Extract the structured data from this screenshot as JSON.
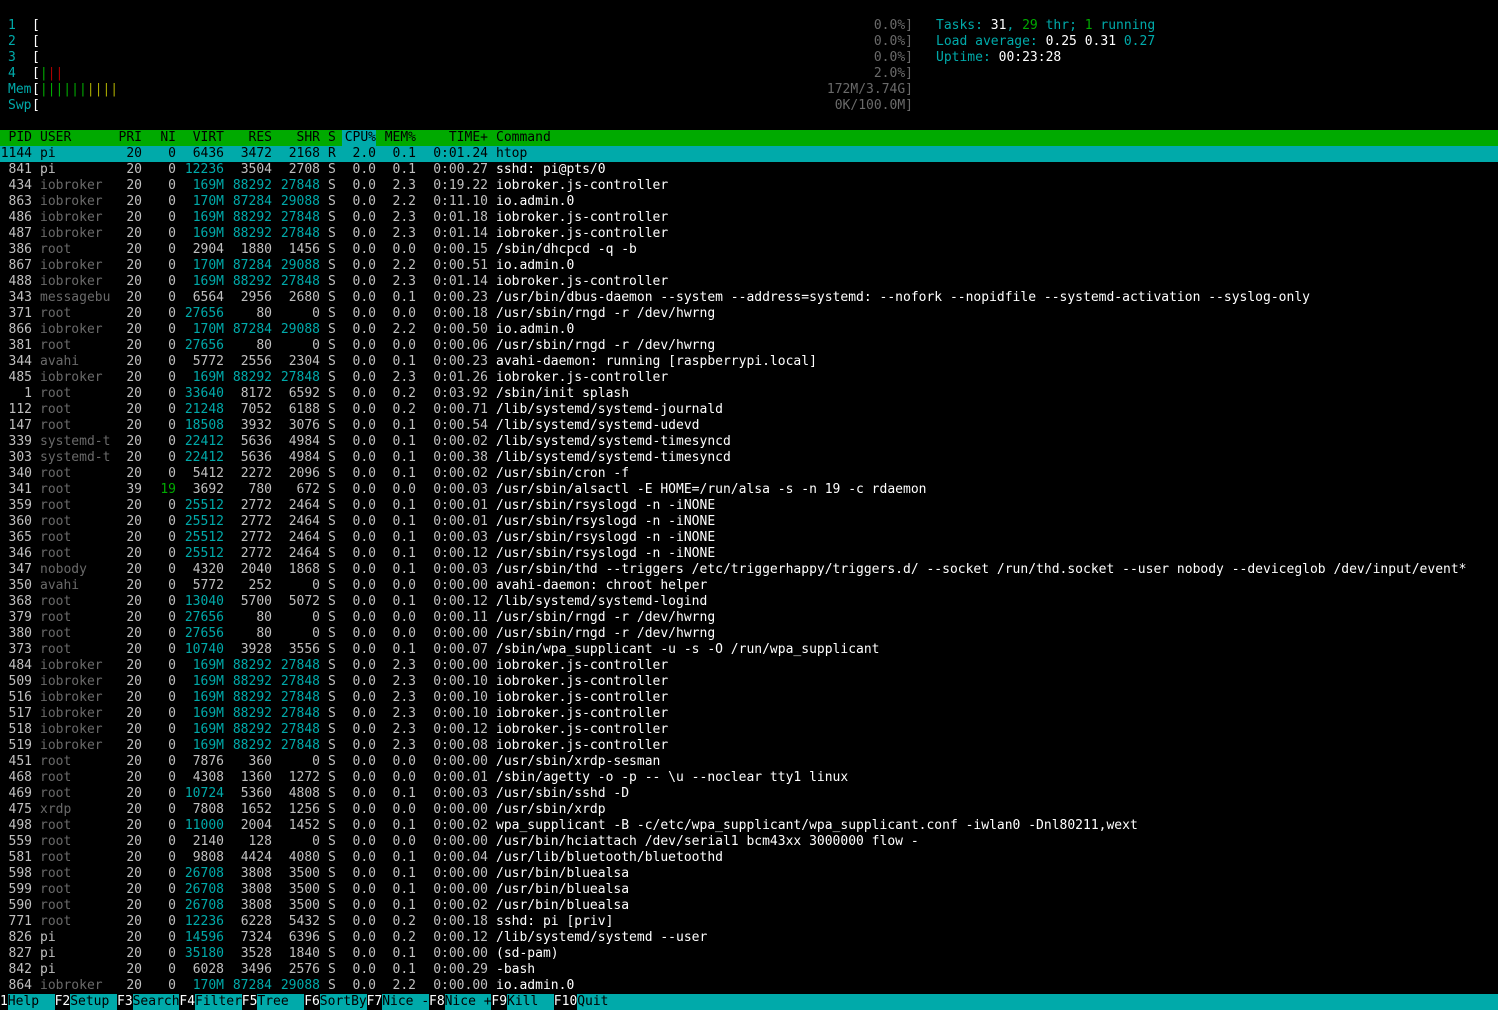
{
  "meters": [
    {
      "label": "1",
      "bar_segments": [],
      "value": "0.0%]"
    },
    {
      "label": "2",
      "bar_segments": [],
      "value": "0.0%]"
    },
    {
      "label": "3",
      "bar_segments": [],
      "value": "0.0%]"
    },
    {
      "label": "4",
      "bar_segments": [
        {
          "text": "|",
          "cls": "g"
        },
        {
          "text": "||",
          "cls": "r"
        }
      ],
      "value": "2.0%]"
    },
    {
      "label": "Mem",
      "bar_segments": [
        {
          "text": "||||||",
          "cls": "g"
        },
        {
          "text": "||||",
          "cls": "y"
        }
      ],
      "value": "172M/3.74G]"
    },
    {
      "label": "Swp",
      "bar_segments": [],
      "value": "0K/100.0M]"
    }
  ],
  "summary": {
    "tasks_label": "Tasks: ",
    "tasks_count": "31",
    "tasks_sep": ", ",
    "thr_count": "29",
    "thr_label": " thr; ",
    "running_count": "1",
    "running_label": " running",
    "load_label": "Load average: ",
    "load_1": "0.25",
    "load_5": "0.31",
    "load_15": "0.27",
    "uptime_label": "Uptime: ",
    "uptime": "00:23:28"
  },
  "columns": {
    "pid": "PID",
    "user": "USER",
    "pri": "PRI",
    "ni": "NI",
    "virt": "VIRT",
    "res": "RES",
    "shr": "SHR",
    "s": "S",
    "cpu": "CPU%",
    "mem": "MEM%",
    "time": "TIME+",
    "command": "Command"
  },
  "processes": [
    [
      "1144",
      "pi",
      "20",
      "0",
      "6436",
      "3472",
      "2168",
      "R",
      "2.0",
      "0.1",
      "0:01.24",
      "htop",
      "sel"
    ],
    [
      "841",
      "pi",
      "20",
      "0",
      "12236",
      "3504",
      "2708",
      "S",
      "0.0",
      "0.1",
      "0:00.27",
      "sshd: pi@pts/0",
      ""
    ],
    [
      "434",
      "iobroker",
      "20",
      "0",
      "169M",
      "88292",
      "27848",
      "S",
      "0.0",
      "2.3",
      "0:19.22",
      "iobroker.js-controller",
      ""
    ],
    [
      "863",
      "iobroker",
      "20",
      "0",
      "170M",
      "87284",
      "29088",
      "S",
      "0.0",
      "2.2",
      "0:11.10",
      "io.admin.0",
      ""
    ],
    [
      "486",
      "iobroker",
      "20",
      "0",
      "169M",
      "88292",
      "27848",
      "S",
      "0.0",
      "2.3",
      "0:01.18",
      "iobroker.js-controller",
      "thr"
    ],
    [
      "487",
      "iobroker",
      "20",
      "0",
      "169M",
      "88292",
      "27848",
      "S",
      "0.0",
      "2.3",
      "0:01.14",
      "iobroker.js-controller",
      "thr"
    ],
    [
      "386",
      "root",
      "20",
      "0",
      "2904",
      "1880",
      "1456",
      "S",
      "0.0",
      "0.0",
      "0:00.15",
      "/sbin/dhcpcd -q -b",
      ""
    ],
    [
      "867",
      "iobroker",
      "20",
      "0",
      "170M",
      "87284",
      "29088",
      "S",
      "0.0",
      "2.2",
      "0:00.51",
      "io.admin.0",
      "thr"
    ],
    [
      "488",
      "iobroker",
      "20",
      "0",
      "169M",
      "88292",
      "27848",
      "S",
      "0.0",
      "2.3",
      "0:01.14",
      "iobroker.js-controller",
      "thr"
    ],
    [
      "343",
      "messagebu",
      "20",
      "0",
      "6564",
      "2956",
      "2680",
      "S",
      "0.0",
      "0.1",
      "0:00.23",
      "/usr/bin/dbus-daemon --system --address=systemd: --nofork --nopidfile --systemd-activation --syslog-only",
      ""
    ],
    [
      "371",
      "root",
      "20",
      "0",
      "27656",
      "80",
      "0",
      "S",
      "0.0",
      "0.0",
      "0:00.18",
      "/usr/sbin/rngd -r /dev/hwrng",
      ""
    ],
    [
      "866",
      "iobroker",
      "20",
      "0",
      "170M",
      "87284",
      "29088",
      "S",
      "0.0",
      "2.2",
      "0:00.50",
      "io.admin.0",
      "thr"
    ],
    [
      "381",
      "root",
      "20",
      "0",
      "27656",
      "80",
      "0",
      "S",
      "0.0",
      "0.0",
      "0:00.06",
      "/usr/sbin/rngd -r /dev/hwrng",
      "thr"
    ],
    [
      "344",
      "avahi",
      "20",
      "0",
      "5772",
      "2556",
      "2304",
      "S",
      "0.0",
      "0.1",
      "0:00.23",
      "avahi-daemon: running [raspberrypi.local]",
      ""
    ],
    [
      "485",
      "iobroker",
      "20",
      "0",
      "169M",
      "88292",
      "27848",
      "S",
      "0.0",
      "2.3",
      "0:01.26",
      "iobroker.js-controller",
      "thr"
    ],
    [
      "1",
      "root",
      "20",
      "0",
      "33640",
      "8172",
      "6592",
      "S",
      "0.0",
      "0.2",
      "0:03.92",
      "/sbin/init splash",
      ""
    ],
    [
      "112",
      "root",
      "20",
      "0",
      "21248",
      "7052",
      "6188",
      "S",
      "0.0",
      "0.2",
      "0:00.71",
      "/lib/systemd/systemd-journald",
      ""
    ],
    [
      "147",
      "root",
      "20",
      "0",
      "18508",
      "3932",
      "3076",
      "S",
      "0.0",
      "0.1",
      "0:00.54",
      "/lib/systemd/systemd-udevd",
      ""
    ],
    [
      "339",
      "systemd-t",
      "20",
      "0",
      "22412",
      "5636",
      "4984",
      "S",
      "0.0",
      "0.1",
      "0:00.02",
      "/lib/systemd/systemd-timesyncd",
      "thr"
    ],
    [
      "303",
      "systemd-t",
      "20",
      "0",
      "22412",
      "5636",
      "4984",
      "S",
      "0.0",
      "0.1",
      "0:00.38",
      "/lib/systemd/systemd-timesyncd",
      ""
    ],
    [
      "340",
      "root",
      "20",
      "0",
      "5412",
      "2272",
      "2096",
      "S",
      "0.0",
      "0.1",
      "0:00.02",
      "/usr/sbin/cron -f",
      ""
    ],
    [
      "341",
      "root",
      "39",
      "19",
      "3692",
      "780",
      "672",
      "S",
      "0.0",
      "0.0",
      "0:00.03",
      "/usr/sbin/alsactl -E HOME=/run/alsa -s -n 19 -c rdaemon",
      ""
    ],
    [
      "359",
      "root",
      "20",
      "0",
      "25512",
      "2772",
      "2464",
      "S",
      "0.0",
      "0.1",
      "0:00.01",
      "/usr/sbin/rsyslogd -n -iNONE",
      "thr"
    ],
    [
      "360",
      "root",
      "20",
      "0",
      "25512",
      "2772",
      "2464",
      "S",
      "0.0",
      "0.1",
      "0:00.01",
      "/usr/sbin/rsyslogd -n -iNONE",
      "thr"
    ],
    [
      "365",
      "root",
      "20",
      "0",
      "25512",
      "2772",
      "2464",
      "S",
      "0.0",
      "0.1",
      "0:00.03",
      "/usr/sbin/rsyslogd -n -iNONE",
      "thr"
    ],
    [
      "346",
      "root",
      "20",
      "0",
      "25512",
      "2772",
      "2464",
      "S",
      "0.0",
      "0.1",
      "0:00.12",
      "/usr/sbin/rsyslogd -n -iNONE",
      ""
    ],
    [
      "347",
      "nobody",
      "20",
      "0",
      "4320",
      "2040",
      "1868",
      "S",
      "0.0",
      "0.1",
      "0:00.03",
      "/usr/sbin/thd --triggers /etc/triggerhappy/triggers.d/ --socket /run/thd.socket --user nobody --deviceglob /dev/input/event*",
      ""
    ],
    [
      "350",
      "avahi",
      "20",
      "0",
      "5772",
      "252",
      "0",
      "S",
      "0.0",
      "0.0",
      "0:00.00",
      "avahi-daemon: chroot helper",
      ""
    ],
    [
      "368",
      "root",
      "20",
      "0",
      "13040",
      "5700",
      "5072",
      "S",
      "0.0",
      "0.1",
      "0:00.12",
      "/lib/systemd/systemd-logind",
      ""
    ],
    [
      "379",
      "root",
      "20",
      "0",
      "27656",
      "80",
      "0",
      "S",
      "0.0",
      "0.0",
      "0:00.11",
      "/usr/sbin/rngd -r /dev/hwrng",
      "thr"
    ],
    [
      "380",
      "root",
      "20",
      "0",
      "27656",
      "80",
      "0",
      "S",
      "0.0",
      "0.0",
      "0:00.00",
      "/usr/sbin/rngd -r /dev/hwrng",
      "thr"
    ],
    [
      "373",
      "root",
      "20",
      "0",
      "10740",
      "3928",
      "3556",
      "S",
      "0.0",
      "0.1",
      "0:00.07",
      "/sbin/wpa_supplicant -u -s -O /run/wpa_supplicant",
      ""
    ],
    [
      "484",
      "iobroker",
      "20",
      "0",
      "169M",
      "88292",
      "27848",
      "S",
      "0.0",
      "2.3",
      "0:00.00",
      "iobroker.js-controller",
      "thr"
    ],
    [
      "509",
      "iobroker",
      "20",
      "0",
      "169M",
      "88292",
      "27848",
      "S",
      "0.0",
      "2.3",
      "0:00.10",
      "iobroker.js-controller",
      "thr"
    ],
    [
      "516",
      "iobroker",
      "20",
      "0",
      "169M",
      "88292",
      "27848",
      "S",
      "0.0",
      "2.3",
      "0:00.10",
      "iobroker.js-controller",
      "thr"
    ],
    [
      "517",
      "iobroker",
      "20",
      "0",
      "169M",
      "88292",
      "27848",
      "S",
      "0.0",
      "2.3",
      "0:00.10",
      "iobroker.js-controller",
      "thr"
    ],
    [
      "518",
      "iobroker",
      "20",
      "0",
      "169M",
      "88292",
      "27848",
      "S",
      "0.0",
      "2.3",
      "0:00.12",
      "iobroker.js-controller",
      "thr"
    ],
    [
      "519",
      "iobroker",
      "20",
      "0",
      "169M",
      "88292",
      "27848",
      "S",
      "0.0",
      "2.3",
      "0:00.08",
      "iobroker.js-controller",
      "thr"
    ],
    [
      "451",
      "root",
      "20",
      "0",
      "7876",
      "360",
      "0",
      "S",
      "0.0",
      "0.0",
      "0:00.00",
      "/usr/sbin/xrdp-sesman",
      ""
    ],
    [
      "468",
      "root",
      "20",
      "0",
      "4308",
      "1360",
      "1272",
      "S",
      "0.0",
      "0.0",
      "0:00.01",
      "/sbin/agetty -o -p -- \\u --noclear tty1 linux",
      ""
    ],
    [
      "469",
      "root",
      "20",
      "0",
      "10724",
      "5360",
      "4808",
      "S",
      "0.0",
      "0.1",
      "0:00.03",
      "/usr/sbin/sshd -D",
      ""
    ],
    [
      "475",
      "xrdp",
      "20",
      "0",
      "7808",
      "1652",
      "1256",
      "S",
      "0.0",
      "0.0",
      "0:00.00",
      "/usr/sbin/xrdp",
      ""
    ],
    [
      "498",
      "root",
      "20",
      "0",
      "11000",
      "2004",
      "1452",
      "S",
      "0.0",
      "0.1",
      "0:00.02",
      "wpa_supplicant -B -c/etc/wpa_supplicant/wpa_supplicant.conf -iwlan0 -Dnl80211,wext",
      ""
    ],
    [
      "559",
      "root",
      "20",
      "0",
      "2140",
      "128",
      "0",
      "S",
      "0.0",
      "0.0",
      "0:00.00",
      "/usr/bin/hciattach /dev/serial1 bcm43xx 3000000 flow -",
      ""
    ],
    [
      "581",
      "root",
      "20",
      "0",
      "9808",
      "4424",
      "4080",
      "S",
      "0.0",
      "0.1",
      "0:00.04",
      "/usr/lib/bluetooth/bluetoothd",
      ""
    ],
    [
      "598",
      "root",
      "20",
      "0",
      "26708",
      "3808",
      "3500",
      "S",
      "0.0",
      "0.1",
      "0:00.00",
      "/usr/bin/bluealsa",
      "thr"
    ],
    [
      "599",
      "root",
      "20",
      "0",
      "26708",
      "3808",
      "3500",
      "S",
      "0.0",
      "0.1",
      "0:00.00",
      "/usr/bin/bluealsa",
      "thr"
    ],
    [
      "590",
      "root",
      "20",
      "0",
      "26708",
      "3808",
      "3500",
      "S",
      "0.0",
      "0.1",
      "0:00.02",
      "/usr/bin/bluealsa",
      ""
    ],
    [
      "771",
      "root",
      "20",
      "0",
      "12236",
      "6228",
      "5432",
      "S",
      "0.0",
      "0.2",
      "0:00.18",
      "sshd: pi [priv]",
      ""
    ],
    [
      "826",
      "pi",
      "20",
      "0",
      "14596",
      "7324",
      "6396",
      "S",
      "0.0",
      "0.2",
      "0:00.12",
      "/lib/systemd/systemd --user",
      ""
    ],
    [
      "827",
      "pi",
      "20",
      "0",
      "35180",
      "3528",
      "1840",
      "S",
      "0.0",
      "0.1",
      "0:00.00",
      "(sd-pam)",
      ""
    ],
    [
      "842",
      "pi",
      "20",
      "0",
      "6028",
      "3496",
      "2576",
      "S",
      "0.0",
      "0.1",
      "0:00.29",
      "-bash",
      ""
    ],
    [
      "864",
      "iobroker",
      "20",
      "0",
      "170M",
      "87284",
      "29088",
      "S",
      "0.0",
      "2.2",
      "0:00.00",
      "io.admin.0",
      "thr"
    ]
  ],
  "footer": [
    {
      "key": "1",
      "label": "Help  "
    },
    {
      "key": "F2",
      "label": "Setup "
    },
    {
      "key": "F3",
      "label": "Search"
    },
    {
      "key": "F4",
      "label": "Filter"
    },
    {
      "key": "F5",
      "label": "Tree  "
    },
    {
      "key": "F6",
      "label": "SortBy"
    },
    {
      "key": "F7",
      "label": "Nice -"
    },
    {
      "key": "F8",
      "label": "Nice +"
    },
    {
      "key": "F9",
      "label": "Kill  "
    },
    {
      "key": "F10",
      "label": "Quit"
    }
  ],
  "colors": {
    "header_bg": "#00aa00",
    "selected_bg": "#00aaaa",
    "thread_cmd": "#00aa00",
    "accent": "#00aaaa"
  }
}
